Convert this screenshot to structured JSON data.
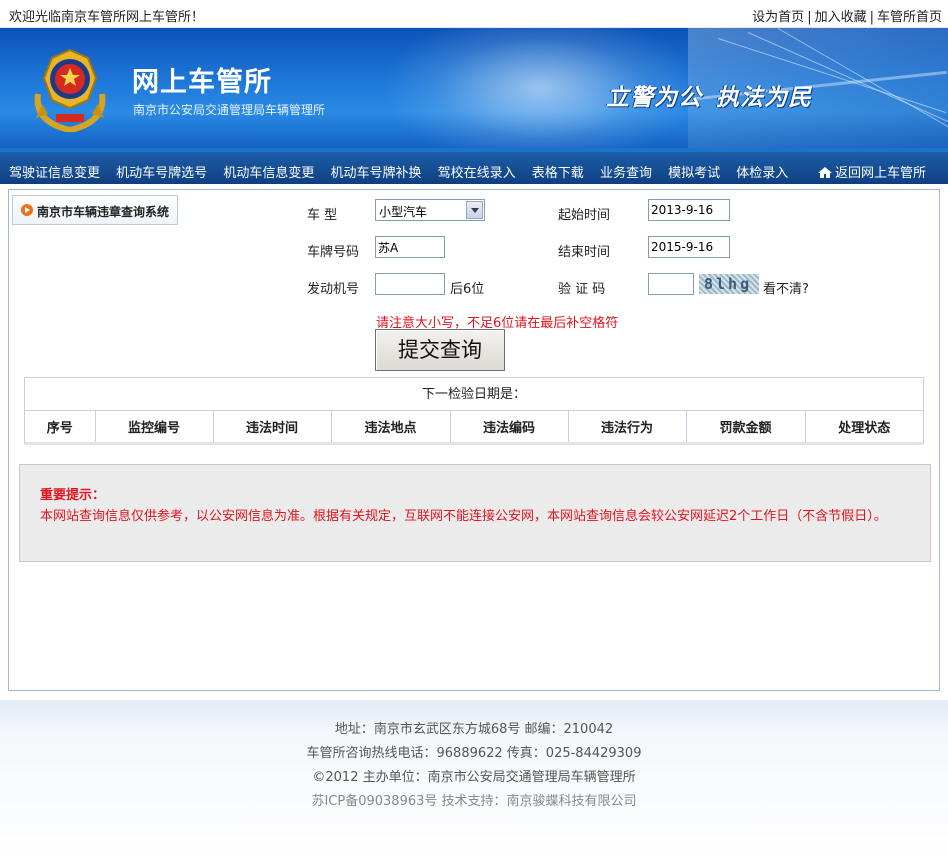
{
  "topbar": {
    "welcome": "欢迎光临南京车管所网上车管所！",
    "links": [
      "设为首页",
      "加入收藏",
      "车管所首页"
    ]
  },
  "banner": {
    "title": "网上车管所",
    "subtitle": "南京市公安局交通管理局车辆管理所",
    "slogan_part1": "立警为公",
    "slogan_part2": "执法为民"
  },
  "nav": {
    "items": [
      "驾驶证信息变更",
      "机动车号牌选号",
      "机动车信息变更",
      "机动车号牌补换",
      "驾校在线录入",
      "表格下载",
      "业务查询",
      "模拟考试",
      "体检录入"
    ],
    "back_label": "返回网上车管所"
  },
  "sidebar": {
    "tab_label": "南京市车辆违章查询系统"
  },
  "form": {
    "vehicle_type_label": "车 型",
    "vehicle_type_value": "小型汽车",
    "plate_label": "车牌号码",
    "plate_value": "苏A",
    "engine_label": "发动机号",
    "engine_value": "",
    "engine_suffix": "后6位",
    "start_label": "起始时间",
    "start_value": "2013-9-16",
    "end_label": "结束时间",
    "end_value": "2015-9-16",
    "captcha_label": "验 证 码",
    "captcha_value": "",
    "captcha_image_text": "8lhg",
    "captcha_refresh": "看不清?",
    "warning": "请注意大小写，不足6位请在最后补空格符",
    "submit_label": "提交查询"
  },
  "results": {
    "caption": "下一检验日期是：",
    "columns": [
      "序号",
      "监控编号",
      "违法时间",
      "违法地点",
      "违法编码",
      "违法行为",
      "罚款金额",
      "处理状态"
    ]
  },
  "notice": {
    "head": "重要提示：",
    "body": "本网站查询信息仅供参考，以公安网信息为准。根据有关规定，互联网不能连接公安网，本网站查询信息会较公安网延迟2个工作日（不含节假日）。"
  },
  "footer": {
    "address": "地址：南京市玄武区东方城68号 邮编：210042",
    "phone": "车管所咨询热线电话：96889622 传真：025-84429309",
    "copyright": "©2012 主办单位：南京市公安局交通管理局车辆管理所",
    "icp": "苏ICP备09038963号 技术支持：南京骏蝶科技有限公司"
  },
  "colors": {
    "banner_blue": "#1e78d8",
    "nav_blue": "#0f3f82",
    "warning_red": "#e0141e",
    "notice_bg": "#ebebeb"
  }
}
